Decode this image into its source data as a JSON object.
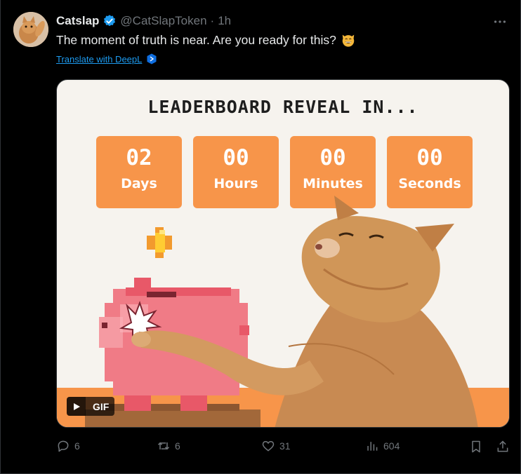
{
  "tweet": {
    "author_name": "Catslap",
    "handle": "@CatSlapToken",
    "separator": "·",
    "time": "1h",
    "text": "The moment of truth is near. Are you ready for this?",
    "emoji": "grinning-cat-face",
    "translate_label": "Translate with DeepL"
  },
  "media": {
    "title": "LEADERBOARD REVEAL IN...",
    "countdown": [
      {
        "value": "02",
        "label": "Days"
      },
      {
        "value": "00",
        "label": "Hours"
      },
      {
        "value": "00",
        "label": "Minutes"
      },
      {
        "value": "00",
        "label": "Seconds"
      }
    ],
    "badge": "GIF",
    "accent_color": "#f7954a"
  },
  "actions": {
    "replies": "6",
    "reposts": "6",
    "likes": "31",
    "views": "604"
  },
  "colors": {
    "background": "#000000",
    "text_primary": "#e7e9ea",
    "text_secondary": "#71767b",
    "link": "#1d9bf0",
    "verified": "#1d9bf0"
  }
}
